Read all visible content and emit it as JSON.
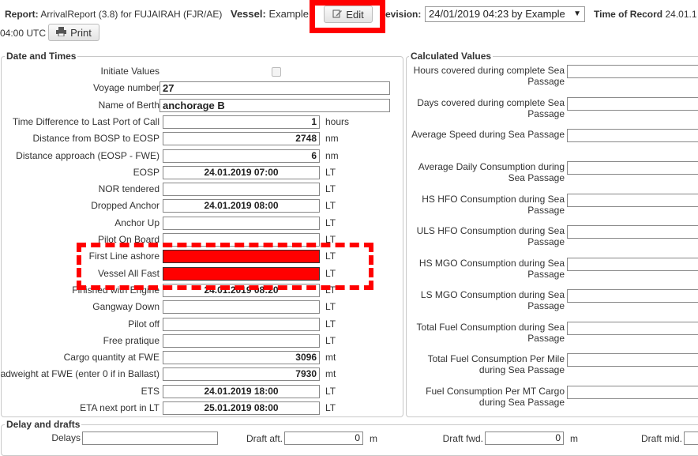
{
  "header": {
    "report_label": "Report:",
    "report_value": "ArrivalReport (3.8) for FUJAIRAH (FJR/AE)",
    "vessel_label": "Vessel:",
    "vessel_value": "Example",
    "edit_label": "Edit",
    "revision_label": "evision:",
    "revision_value": "24/01/2019 04:23 by",
    "revision_by": "Example",
    "time_label": "Time of Record",
    "time_value": "24.01.1",
    "time_cont": "04:00 UTC",
    "print_label": "Print",
    "highlight_color": "#ff0000"
  },
  "date_times": {
    "legend": "Date and Times",
    "rows": [
      {
        "label": "Initiate Values",
        "value": "",
        "unit": "",
        "kind": "checkbox"
      },
      {
        "label": "Voyage number",
        "value": "27",
        "unit": "",
        "kind": "txt"
      },
      {
        "label": "Name of Berth",
        "value": "anchorage B",
        "unit": "",
        "kind": "txt"
      },
      {
        "label": "Time Difference to Last Port of Call",
        "value": "1",
        "unit": "hours",
        "kind": "num"
      },
      {
        "label": "Distance from BOSP to EOSP",
        "value": "2748",
        "unit": "nm",
        "kind": "num"
      },
      {
        "label": "Distance approach (EOSP - FWE)",
        "value": "6",
        "unit": "nm",
        "kind": "num"
      },
      {
        "label": "EOSP",
        "value": "24.01.2019 07:00",
        "unit": "LT",
        "kind": "dt"
      },
      {
        "label": "NOR tendered",
        "value": "",
        "unit": "LT",
        "kind": "dt"
      },
      {
        "label": "Dropped Anchor",
        "value": "24.01.2019 08:00",
        "unit": "LT",
        "kind": "dt"
      },
      {
        "label": "Anchor Up",
        "value": "",
        "unit": "LT",
        "kind": "dt"
      },
      {
        "label": "Pilot On Board",
        "value": "",
        "unit": "LT",
        "kind": "dt"
      },
      {
        "label": "First Line ashore",
        "value": "",
        "unit": "LT",
        "kind": "red"
      },
      {
        "label": "Vessel All Fast",
        "value": "",
        "unit": "LT",
        "kind": "red"
      },
      {
        "label": "Finished with Engine",
        "value": "24.01.2019 08:20",
        "unit": "LT",
        "kind": "dt"
      },
      {
        "label": "Gangway Down",
        "value": "",
        "unit": "LT",
        "kind": "dt"
      },
      {
        "label": "Pilot off",
        "value": "",
        "unit": "LT",
        "kind": "dt"
      },
      {
        "label": "Free pratique",
        "value": "",
        "unit": "LT",
        "kind": "dt"
      },
      {
        "label": "Cargo quantity at FWE",
        "value": "3096",
        "unit": "mt",
        "kind": "num"
      },
      {
        "label": "Deadweight at FWE (enter 0 if in Ballast)",
        "value": "7930",
        "unit": "mt",
        "kind": "num"
      },
      {
        "label": "ETS",
        "value": "24.01.2019 18:00",
        "unit": "LT",
        "kind": "dt"
      },
      {
        "label": "ETA next port in LT",
        "value": "25.01.2019 08:00",
        "unit": "LT",
        "kind": "dt"
      }
    ]
  },
  "calculated": {
    "legend": "Calculated Values",
    "rows": [
      {
        "label": "Hours covered during complete Sea Passage"
      },
      {
        "label": "Days covered during complete Sea Passage"
      },
      {
        "label": "Average Speed during Sea Passage"
      },
      {
        "label": "Average Daily Consumption during Sea Passage"
      },
      {
        "label": "HS HFO Consumption during Sea Passage"
      },
      {
        "label": "ULS HFO Consumption during Sea Passage"
      },
      {
        "label": "HS MGO Consumption during Sea Passage"
      },
      {
        "label": "LS MGO Consumption during Sea Passage"
      },
      {
        "label": "Total Fuel Consumption during Sea Passage"
      },
      {
        "label": "Total Fuel Consumption Per Mile during Sea Passage"
      },
      {
        "label": "Fuel Consumption Per MT Cargo during Sea Passage"
      }
    ]
  },
  "delay": {
    "legend": "Delay and drafts",
    "delays_label": "Delays",
    "draft_aft_label": "Draft aft.",
    "draft_aft_value": "0",
    "draft_fwd_label": "Draft fwd.",
    "draft_fwd_value": "0",
    "draft_mid_label": "Draft mid.",
    "unit_m": "m"
  }
}
